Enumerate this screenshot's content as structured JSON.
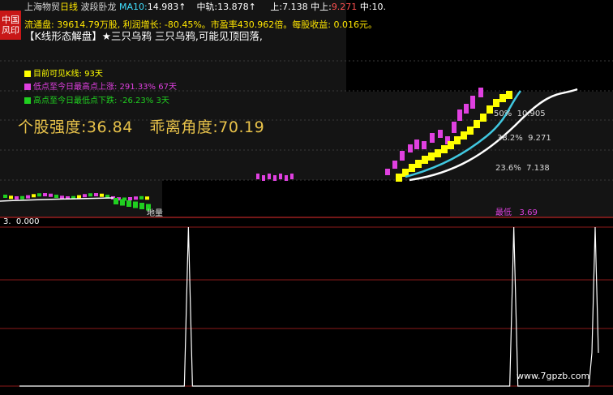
{
  "header": {
    "stock_name": "上海物贸",
    "period": "日线",
    "indicator_name": "波段卧龙",
    "ma_label": "MA10:",
    "ma_value": "14.983↑",
    "mid_label": "中轨:",
    "mid_value": "13.878↑",
    "upper_label": "上:",
    "upper_value": "7.138",
    "zhongshang_label": "中上:",
    "zhongshang_value": "9.271",
    "zhong_label": "中:",
    "zhong_value": "10."
  },
  "logo": {
    "line1": "中国",
    "line2": "风印"
  },
  "info_line": "流通盘: 39614.79万股, 利润增长: -80.45%。市盈率430.962倍。每股收益: 0.016元。",
  "title_line": "【K线形态解盘】★三只乌鸦 三只乌鸦,可能见顶回落,",
  "legends": [
    {
      "text": "目前可见K线: 93天",
      "color": "#ffff00"
    },
    {
      "text": "低点至今日最高点上涨: 291.33% 67天",
      "color": "#e040e0"
    },
    {
      "text": "高点至今日最低点下跌: -26.23% 3天",
      "color": "#20d020"
    }
  ],
  "strength": {
    "label1": "个股强度:",
    "value1": "36.84",
    "label2": "乖离角度:",
    "value2": "70.19"
  },
  "fib_levels": [
    {
      "pct": "50%",
      "price": "10.905"
    },
    {
      "pct": "38.2%",
      "price": "9.271"
    },
    {
      "pct": "23.6%",
      "price": "7.138"
    }
  ],
  "min_label": "最低",
  "min_value": "3.69",
  "bottom_marker": "地量",
  "lower_panel": {
    "label_prefix": "3.",
    "value": "0.000"
  },
  "watermark": "www.7gpzb.com",
  "colors": {
    "up_candle": "#e040e0",
    "down_candle": "#20d020",
    "yellow_band": "#ffff00",
    "white_line": "#ffffff",
    "cyan_line": "#40c8e0",
    "grid_red": "#8b1a1a"
  },
  "chart_data": {
    "type": "line",
    "title": "",
    "xlabel": "",
    "ylabel": "",
    "x": [
      1,
      2,
      3,
      4,
      5,
      6,
      7,
      8,
      9,
      10,
      11,
      12,
      13,
      14,
      15,
      16,
      17,
      18,
      19,
      20,
      21,
      22,
      23,
      24,
      25,
      26,
      27,
      28,
      29,
      30,
      31,
      32,
      33,
      34,
      35,
      36,
      37,
      38,
      39,
      40,
      41,
      42,
      43,
      44,
      45,
      46,
      47,
      48,
      49,
      50,
      51,
      52,
      53,
      54,
      55,
      56,
      57,
      58,
      59,
      60,
      61,
      62,
      63,
      64,
      65,
      66,
      67,
      68,
      69,
      70,
      71,
      72,
      73,
      74,
      75,
      76,
      77,
      78,
      79,
      80,
      81,
      82,
      83,
      84,
      85,
      86,
      87,
      88,
      89,
      90,
      91,
      92,
      93
    ],
    "series": [
      {
        "values": [
          0,
          0,
          0,
          0,
          0,
          0,
          0,
          0,
          0,
          0,
          0,
          0,
          0,
          0,
          0,
          0,
          0,
          0,
          0,
          0,
          0,
          0,
          0,
          0,
          0,
          0,
          0,
          1,
          0,
          0,
          0,
          0,
          0,
          0,
          0,
          0,
          0,
          0,
          0,
          0,
          0,
          0,
          0,
          0,
          0,
          0,
          0,
          0,
          0,
          0,
          0,
          0,
          0,
          0,
          0,
          0,
          0,
          0,
          0,
          0,
          0,
          0,
          0,
          0,
          0,
          0,
          0,
          0,
          0,
          0,
          0,
          0,
          0,
          0,
          0,
          0,
          0,
          0,
          0,
          1,
          0,
          0,
          0,
          0,
          0,
          0,
          0,
          0,
          0,
          0,
          0,
          0,
          1
        ]
      }
    ],
    "ylim": [
      0,
      1
    ],
    "grid": true
  }
}
